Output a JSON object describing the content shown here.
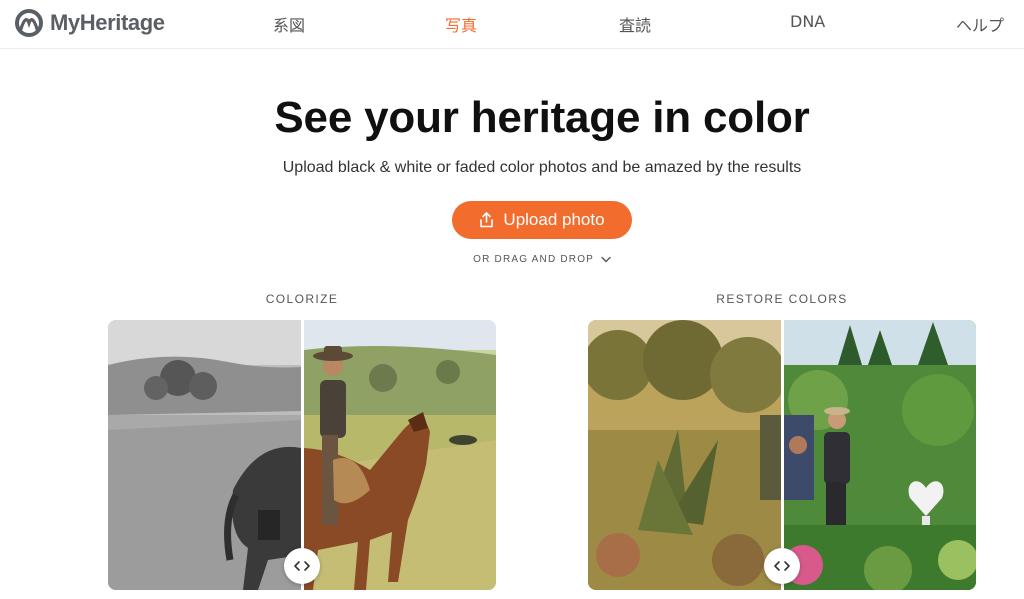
{
  "header": {
    "logo_text": "MyHeritage",
    "nav": [
      {
        "label": "系図",
        "active": false
      },
      {
        "label": "写真",
        "active": true
      },
      {
        "label": "査読",
        "active": false
      },
      {
        "label": "DNA",
        "active": false
      },
      {
        "label": "ヘルプ",
        "active": false
      }
    ]
  },
  "hero": {
    "title": "See your heritage in color",
    "subtitle": "Upload black & white or faded color photos and be amazed by the results",
    "upload_label": "Upload photo",
    "drag_drop_label": "OR DRAG AND DROP"
  },
  "demos": [
    {
      "label": "COLORIZE"
    },
    {
      "label": "RESTORE COLORS"
    }
  ],
  "colors": {
    "accent": "#f26c2e",
    "logo_gray": "#5a5f66",
    "nav_text": "#555555"
  },
  "icons": [
    "logo-icon",
    "upload-icon",
    "chevron-down-icon",
    "compare-arrows-icon"
  ]
}
